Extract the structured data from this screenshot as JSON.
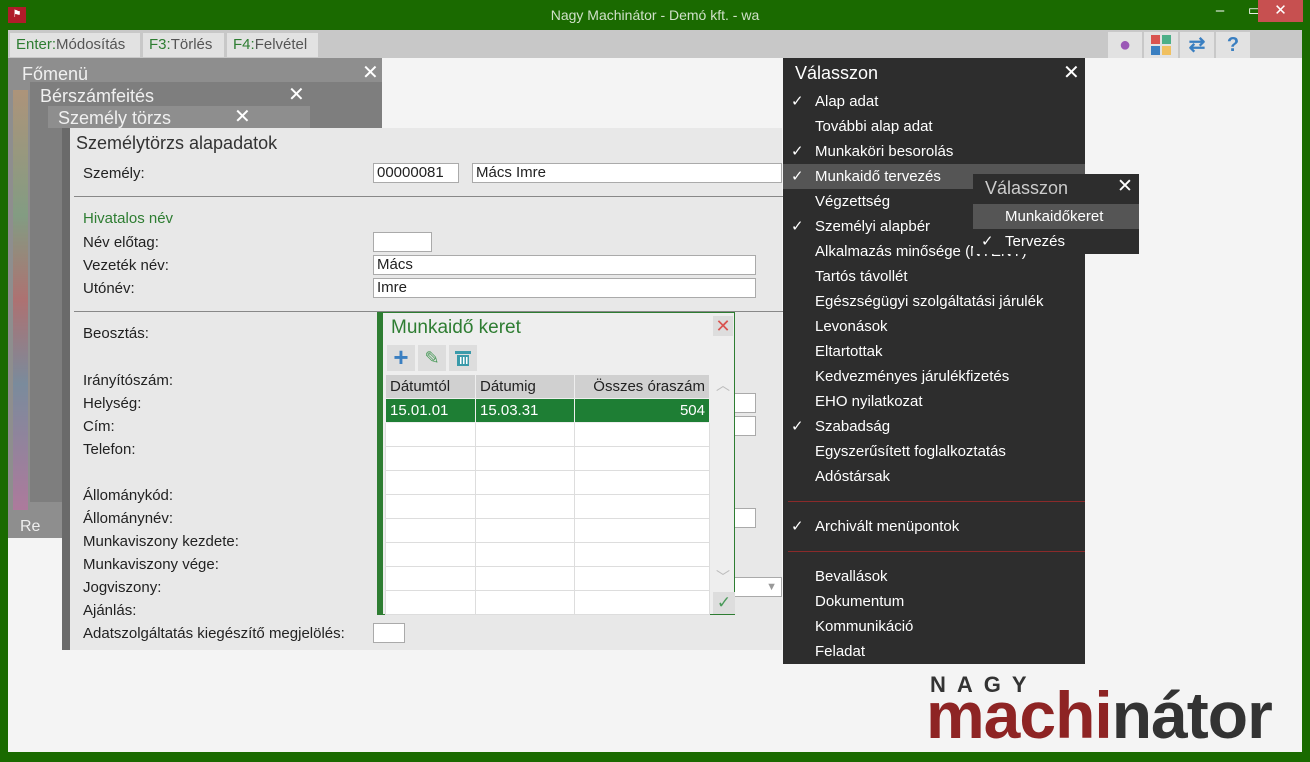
{
  "window": {
    "title": "Nagy Machinátor - Demó kft. - wa",
    "app_icon": "app-logo-icon",
    "colors": {
      "frame": "#1a6a00",
      "accent": "#2e7d32",
      "menu_bg": "#2d2d2d"
    }
  },
  "toolbar": {
    "buttons": [
      {
        "key": "Enter:",
        "label": "Módosítás"
      },
      {
        "key": "F3:",
        "label": "Törlés"
      },
      {
        "key": "F4:",
        "label": "Felvétel"
      }
    ],
    "icons": [
      "user-icon",
      "tiles-icon",
      "swap-arrows-icon",
      "help-icon"
    ],
    "help_glyph": "?"
  },
  "menus": {
    "main": "Főmenü",
    "payroll": "Bérszámfeités",
    "person": "Személy törzs",
    "peek": "Re"
  },
  "form": {
    "title": "Személytörzs alapadatok",
    "person_label": "Személy:",
    "person_id": "00000081",
    "person_name": "Mács Imre",
    "official_name": "Hivatalos név",
    "prefix_label": "Név előtag:",
    "prefix_value": "",
    "surname_label": "Vezeték név:",
    "surname_value": "Mács",
    "given_label": "Utónév:",
    "given_value": "Imre",
    "labels": [
      "Beosztás:",
      "Irányítószám:",
      "Helység:",
      "Cím:",
      "Telefon:",
      "Állománykód:",
      "Állománynév:",
      "Munkaviszony kezdete:",
      "Munkaviszony vége:",
      "Jogviszony:",
      "Ajánlás:",
      "Adatszolgáltatás kiegészítő megjelölés:"
    ]
  },
  "dialog": {
    "title": "Munkaidő keret",
    "tools": [
      "add-icon",
      "edit-icon",
      "delete-icon"
    ],
    "columns": [
      "Dátumtól",
      "Dátumig",
      "Összes óraszám"
    ],
    "rows": [
      [
        "15.01.01",
        "15.03.31",
        "504"
      ]
    ]
  },
  "choose_menu": {
    "title": "Válasszon",
    "items": [
      {
        "label": "Alap adat",
        "checked": true
      },
      {
        "label": "További alap adat",
        "checked": false
      },
      {
        "label": "Munkaköri besorolás",
        "checked": true
      },
      {
        "label": "Munkaidő tervezés",
        "checked": true,
        "highlighted": true
      },
      {
        "label": "Végzettség",
        "checked": false
      },
      {
        "label": "Személyi alapbér",
        "checked": true
      },
      {
        "label": "Alkalmazás minősége (NYENY)",
        "checked": false
      },
      {
        "label": "Tartós távollét",
        "checked": false
      },
      {
        "label": "Egészségügyi szolgáltatási járulék",
        "checked": false
      },
      {
        "label": "Levonások",
        "checked": false
      },
      {
        "label": "Eltartottak",
        "checked": false
      },
      {
        "label": "Kedvezményes járulékfizetés",
        "checked": false
      },
      {
        "label": "EHO nyilatkozat",
        "checked": false
      },
      {
        "label": "Szabadság",
        "checked": true
      },
      {
        "label": "Egyszerűsített foglalkoztatás",
        "checked": false
      },
      {
        "label": "Adóstársak",
        "checked": false
      }
    ],
    "archived": {
      "label": "Archivált menüpontok",
      "checked": true
    },
    "bottom": [
      "Bevallások",
      "Dokumentum",
      "Kommunikáció",
      "Feladat"
    ]
  },
  "submenu": {
    "title": "Válasszon",
    "items": [
      {
        "label": "Munkaidőkeret",
        "checked": false,
        "highlighted": true
      },
      {
        "label": "Tervezés",
        "checked": true
      }
    ]
  },
  "logo": {
    "top": "NAGY",
    "red": "machi",
    "dark": "nátor"
  }
}
